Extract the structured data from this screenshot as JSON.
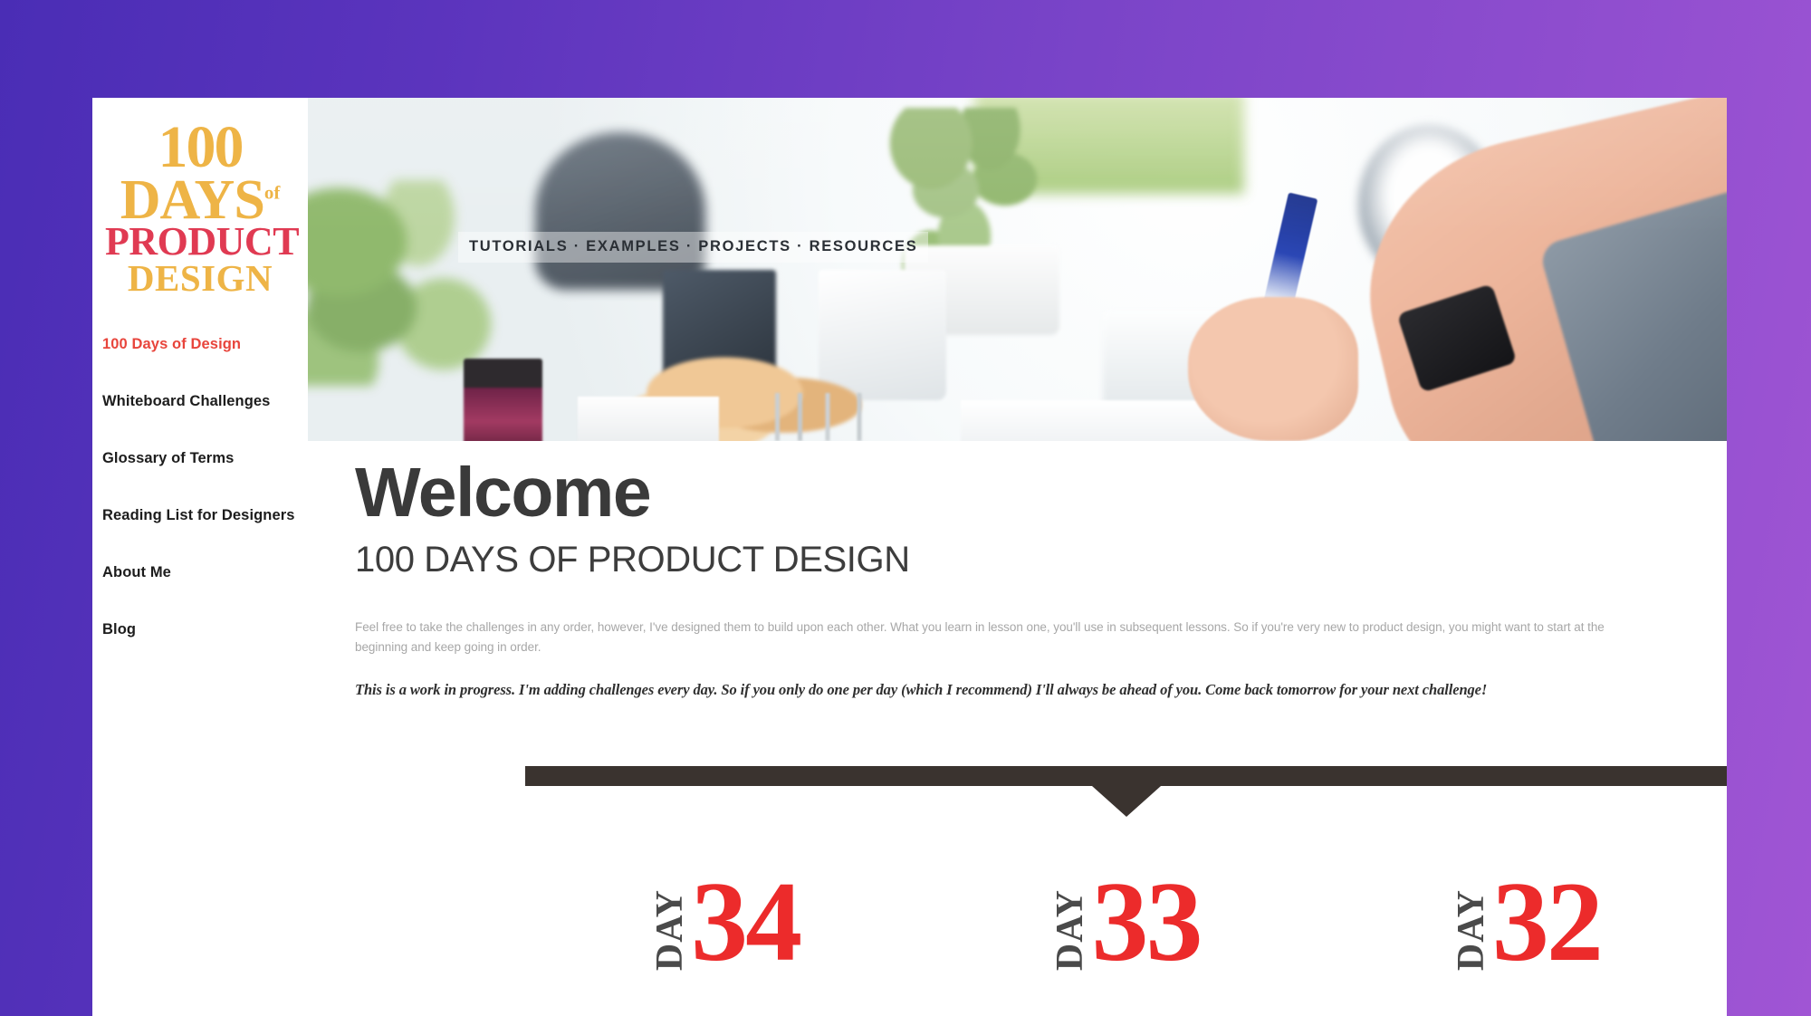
{
  "site": {
    "logo": {
      "line1": "100",
      "line2": "DAYS",
      "line2_sup": "of",
      "line3": "PRODUCT",
      "line4": "DESIGN",
      "color_yellow": "#eeb446",
      "color_red": "#e03a52"
    },
    "accent_red": "#e8453c",
    "bg_gradient_start": "#4a2db5",
    "bg_gradient_end": "#a055d4",
    "divider_color": "#3a332f"
  },
  "sidebar": {
    "items": [
      {
        "label": "100 Days of Design",
        "active": true
      },
      {
        "label": "Whiteboard Challenges",
        "active": false
      },
      {
        "label": "Glossary of Terms",
        "active": false
      },
      {
        "label": "Reading List for Designers",
        "active": false
      },
      {
        "label": "About Me",
        "active": false
      },
      {
        "label": "Blog",
        "active": false
      }
    ]
  },
  "hero": {
    "nav_text": "TUTORIALS · EXAMPLES · PROJECTS · RESOURCES"
  },
  "intro": {
    "heading": "Welcome",
    "subheading": "100 DAYS OF PRODUCT DESIGN",
    "paragraph": "Feel free to take the challenges in any order, however, I've designed them to build upon each other. What you learn in lesson one, you'll use in subsequent lessons. So if you're very new to product design, you might want to start at the beginning and keep going in order.",
    "note": "This is a work in progress. I'm adding challenges every day. So if you only do one per day (which I recommend) I'll always be ahead of you. Come back tomorrow for your next challenge!"
  },
  "cards": [
    {
      "day_label": "DAY",
      "number": "34"
    },
    {
      "day_label": "DAY",
      "number": "33"
    },
    {
      "day_label": "DAY",
      "number": "32"
    }
  ]
}
